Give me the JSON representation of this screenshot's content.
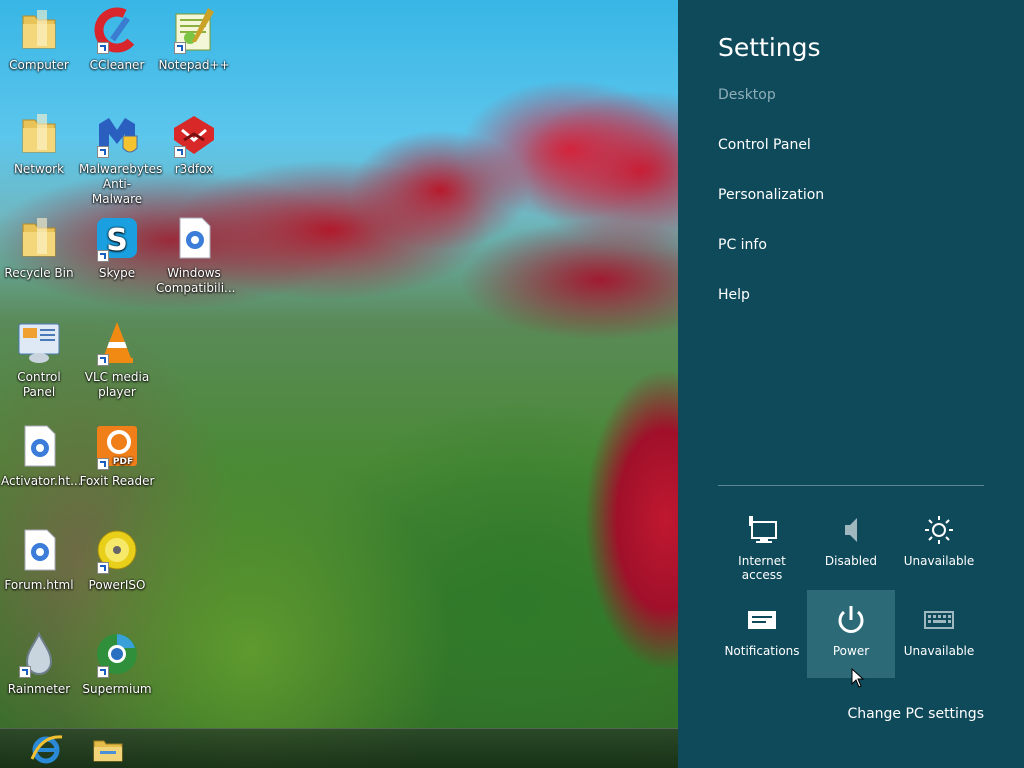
{
  "desktop": {
    "icons": [
      {
        "label": "Computer",
        "icon": "folder-icon"
      },
      {
        "label": "CCleaner",
        "icon": "ccleaner-icon"
      },
      {
        "label": "Notepad++",
        "icon": "notepadpp-icon"
      },
      {
        "label": "Network",
        "icon": "folder-icon"
      },
      {
        "label": "Malwarebytes Anti-Malware",
        "icon": "malwarebytes-icon"
      },
      {
        "label": "r3dfox",
        "icon": "r3dfox-icon"
      },
      {
        "label": "Recycle Bin",
        "icon": "folder-icon"
      },
      {
        "label": "Skype",
        "icon": "skype-icon"
      },
      {
        "label": "Windows Compatibili...",
        "icon": "html-file-icon"
      },
      {
        "label": "Control Panel",
        "icon": "control-panel-icon"
      },
      {
        "label": "VLC media player",
        "icon": "vlc-icon"
      },
      {
        "label": "Activator.ht...",
        "icon": "html-file-icon"
      },
      {
        "label": "Foxit Reader",
        "icon": "foxit-icon"
      },
      {
        "label": "Forum.html",
        "icon": "html-file-icon"
      },
      {
        "label": "PowerISO",
        "icon": "poweriso-icon"
      },
      {
        "label": "Rainmeter",
        "icon": "rainmeter-icon"
      },
      {
        "label": "Supermium",
        "icon": "supermium-icon"
      }
    ],
    "taskbar": [
      {
        "icon": "internet-explorer-icon"
      },
      {
        "icon": "file-explorer-icon"
      }
    ]
  },
  "charm": {
    "title": "Settings",
    "context": "Desktop",
    "links": [
      "Control Panel",
      "Personalization",
      "PC info",
      "Help"
    ],
    "tiles": [
      {
        "label": "Internet access",
        "icon": "network-icon"
      },
      {
        "label": "Disabled",
        "icon": "volume-icon"
      },
      {
        "label": "Unavailable",
        "icon": "brightness-icon"
      },
      {
        "label": "Notifications",
        "icon": "notifications-icon"
      },
      {
        "label": "Power",
        "icon": "power-icon"
      },
      {
        "label": "Unavailable",
        "icon": "keyboard-icon"
      }
    ],
    "change_pc_settings": "Change PC settings",
    "bg_color": "#0f4a5b",
    "active_tile_color": "#2c6a78"
  }
}
